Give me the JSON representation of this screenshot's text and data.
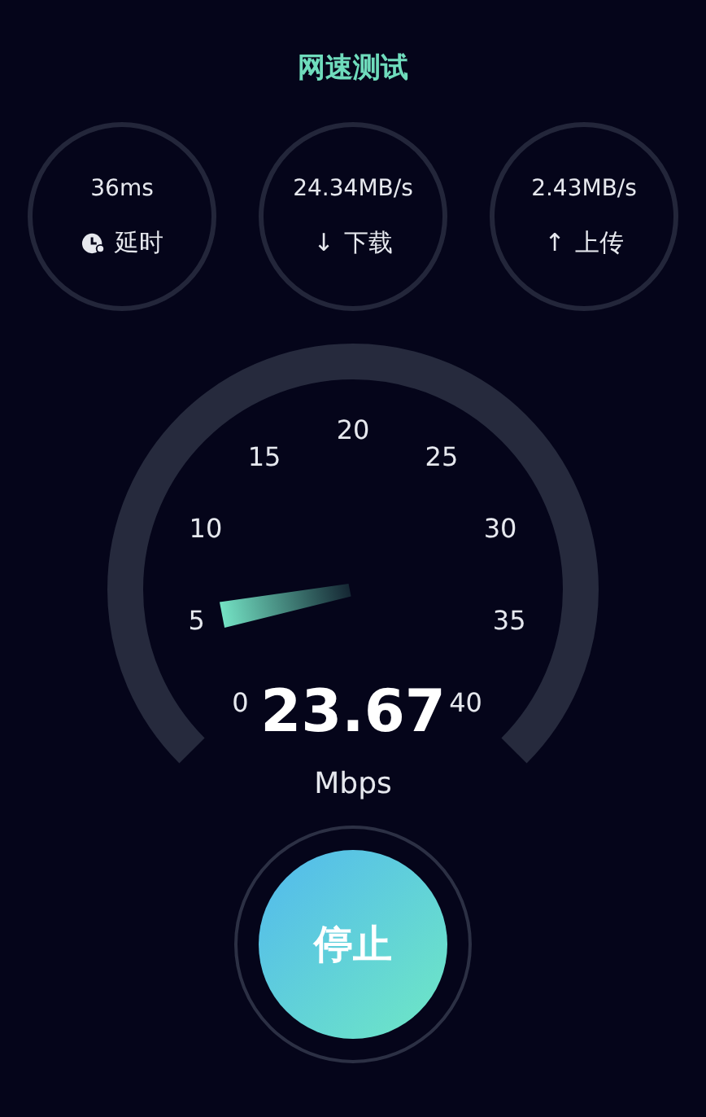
{
  "title": "网速测试",
  "stats": [
    {
      "value": "36ms",
      "label": "延时",
      "kind": "timer"
    },
    {
      "value": "24.34MB/s",
      "label": "下载",
      "kind": "glyph",
      "glyph": "↓"
    },
    {
      "value": "2.43MB/s",
      "label": "上传",
      "kind": "glyph",
      "glyph": "↑"
    }
  ],
  "gauge": {
    "ticks": [
      "0",
      "5",
      "10",
      "15",
      "20",
      "25",
      "30",
      "35",
      "40"
    ],
    "reading": "23.67",
    "unit": "Mbps"
  },
  "button": {
    "label": "停止"
  }
}
